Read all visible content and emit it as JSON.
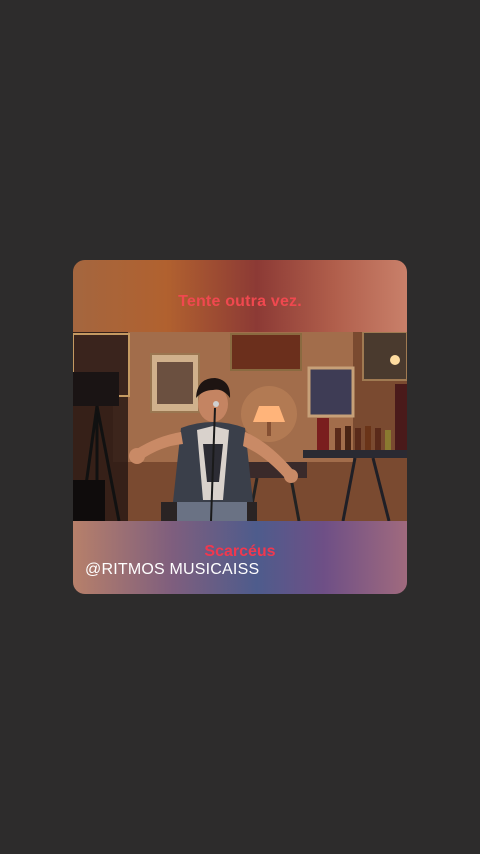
{
  "post": {
    "top_caption": "Tente outra vez.",
    "song_title": "Scarcéus",
    "handle": "@RITMOS MUSICAISS"
  },
  "colors": {
    "background": "#2d2c2c",
    "caption_red": "#f0484f",
    "title_red": "#f0384f",
    "handle_white": "#ffffff"
  },
  "video": {
    "icon": "video-frame"
  }
}
